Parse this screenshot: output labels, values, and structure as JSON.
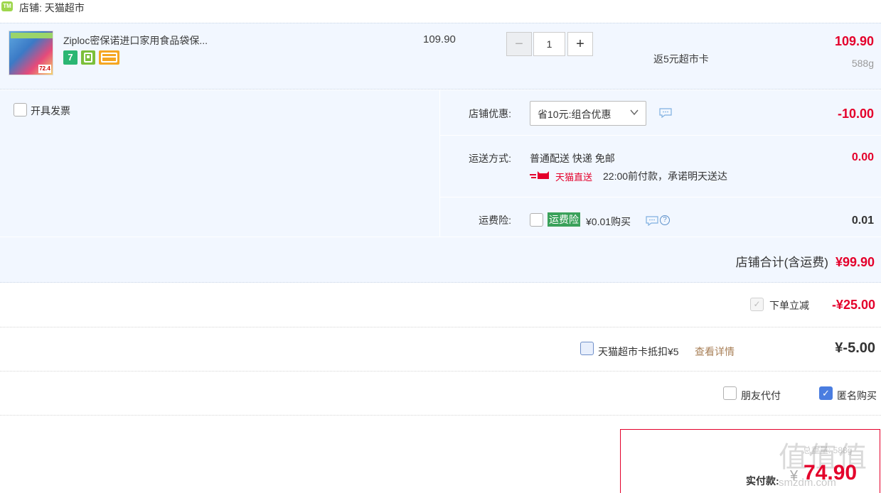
{
  "shop": {
    "icon_text": "TM",
    "label": "店铺: 天猫超市"
  },
  "item": {
    "title": "Ziploc密保诺进口家用食品袋保...",
    "thumb_price": "72.4",
    "badge_seven": "7",
    "unit_price": "109.90",
    "quantity": "1",
    "minus": "−",
    "plus": "+",
    "rebate": "返5元超市卡",
    "total": "109.90",
    "weight": "588g"
  },
  "invoice": {
    "label": "开具发票"
  },
  "shop_discount": {
    "label": "店铺优惠:",
    "selected": "省10元:组合优惠",
    "amount": "-10.00"
  },
  "shipping": {
    "label": "运送方式:",
    "method": "普通配送 快递 免邮",
    "tmall_direct": "天猫直送",
    "promise": "22:00前付款，承诺明天送达",
    "amount": "0.00"
  },
  "insurance": {
    "label": "运费险:",
    "tag": "运费险",
    "text": "¥0.01购买",
    "help": "?",
    "amount": "0.01"
  },
  "shop_total": {
    "label": "店铺合计(含运费)",
    "amount": "¥99.90"
  },
  "order_reduce": {
    "check": "✓",
    "label": "下单立减",
    "amount": "-¥25.00"
  },
  "supermarket_card": {
    "label": "天猫超市卡抵扣¥5",
    "link": "查看详情",
    "amount": "¥-5.00"
  },
  "options": {
    "friend_pay": "朋友代付",
    "anonymous": "匿名购买",
    "check": "✓"
  },
  "pay": {
    "label": "实付款:",
    "currency": "¥",
    "amount": "74.90",
    "watermark": "值值值",
    "watermark_sub": "总重量: 588g",
    "watermark_url": "smzdm.com"
  },
  "colors": {
    "accent_red": "#e4002b",
    "panel_blue": "#f2f7ff",
    "link_brown": "#a87f57",
    "check_blue": "#4a7de0"
  }
}
